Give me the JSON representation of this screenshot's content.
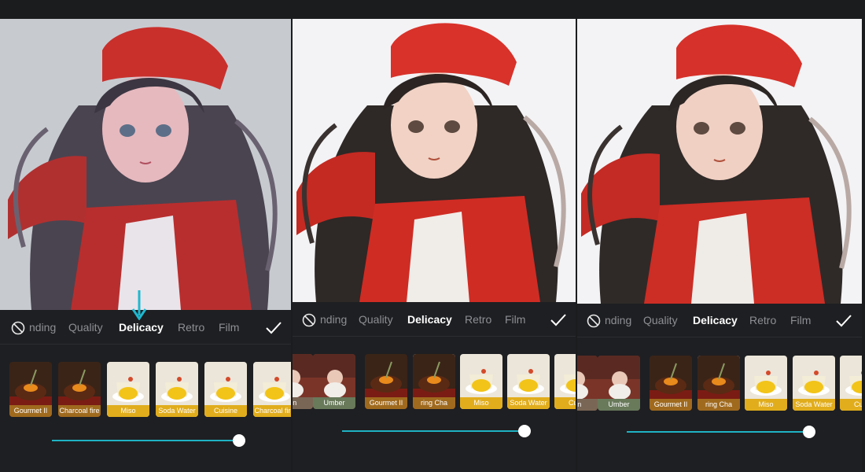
{
  "panels": [
    {
      "tabs": [
        "nding",
        "Quality",
        "Delicacy",
        "Retro",
        "Film"
      ],
      "active_tab": "Delicacy",
      "filters": [
        {
          "label": "Gourmet II",
          "kind": "steak",
          "color": "#a06a1e"
        },
        {
          "label": "Charcoal fire",
          "kind": "steak",
          "color": "#a06a1e"
        },
        {
          "label": "Miso",
          "kind": "dessert",
          "color": "#e1ad1c"
        },
        {
          "label": "Soda Water",
          "kind": "dessert",
          "color": "#e1ad1c"
        },
        {
          "label": "Cuisine",
          "kind": "dessert",
          "color": "#e1ad1c"
        },
        {
          "label": "Charcoal fire",
          "kind": "dessert",
          "color": "#e1ad1c"
        }
      ],
      "selected_filter": -1,
      "intensity": 1.0
    },
    {
      "tabs": [
        "nding",
        "Quality",
        "Delicacy",
        "Retro",
        "Film"
      ],
      "active_tab": "Delicacy",
      "filters": [
        {
          "label": "mn",
          "kind": "person",
          "color": "#7a6655"
        },
        {
          "label": "Umber",
          "kind": "person",
          "color": "#687a5a"
        },
        {
          "label": "Gourmet II",
          "kind": "steak",
          "color": "#a06a1e"
        },
        {
          "label": "ring Cha",
          "kind": "steak",
          "color": "#a06a1e"
        },
        {
          "label": "Miso",
          "kind": "dessert",
          "color": "#e1ad1c"
        },
        {
          "label": "Soda Water",
          "kind": "dessert",
          "color": "#e1ad1c"
        },
        {
          "label": "Cuis",
          "kind": "dessert",
          "color": "#e1ad1c"
        }
      ],
      "selected_filter": 3,
      "intensity": 1.0
    },
    {
      "tabs": [
        "nding",
        "Quality",
        "Delicacy",
        "Retro",
        "Film"
      ],
      "active_tab": "Delicacy",
      "filters": [
        {
          "label": "mn",
          "kind": "person",
          "color": "#7a6655"
        },
        {
          "label": "Umber",
          "kind": "person",
          "color": "#687a5a"
        },
        {
          "label": "Gourmet II",
          "kind": "steak",
          "color": "#a06a1e"
        },
        {
          "label": "ring Cha",
          "kind": "steak",
          "color": "#a06a1e"
        },
        {
          "label": "Miso",
          "kind": "dessert",
          "color": "#e1ad1c"
        },
        {
          "label": "Soda Water",
          "kind": "dessert",
          "color": "#e1ad1c"
        },
        {
          "label": "Cuis",
          "kind": "dessert",
          "color": "#e1ad1c"
        }
      ],
      "selected_filter": 3,
      "intensity": 1.0
    }
  ],
  "icons": {
    "none": "no-filter-icon",
    "confirm": "checkmark-icon",
    "pointer": "down-arrow-icon"
  },
  "colors": {
    "accent": "#1fb2c4",
    "panel_bg": "#1e1f22",
    "hat": "#d8322a",
    "jacket": "#c8302a"
  }
}
